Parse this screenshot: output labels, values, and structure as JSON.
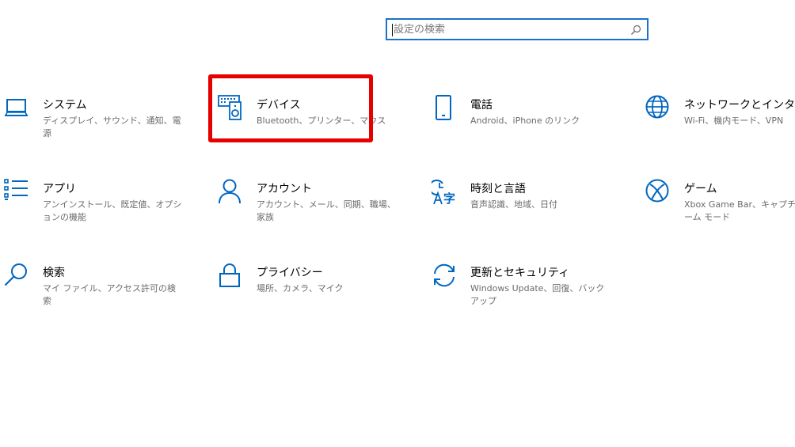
{
  "search": {
    "placeholder": "設定の検索",
    "value": ""
  },
  "accent_color": "#0067c0",
  "highlight_color": "#e60000",
  "categories": [
    {
      "icon": "laptop-icon",
      "title": "システム",
      "desc": "ディスプレイ、サウンド、通知、電源"
    },
    {
      "icon": "devices-icon",
      "title": "デバイス",
      "desc": "Bluetooth、プリンター、マウス"
    },
    {
      "icon": "phone-icon",
      "title": "電話",
      "desc": "Android、iPhone のリンク"
    },
    {
      "icon": "globe-icon",
      "title": "ネットワークとインターネット",
      "desc": "Wi-Fi、機内モード、VPN"
    },
    {
      "icon": "apps-icon",
      "title": "アプリ",
      "desc": "アンインストール、既定値、オプションの機能"
    },
    {
      "icon": "person-icon",
      "title": "アカウント",
      "desc": "アカウント、メール、同期、職場、家族"
    },
    {
      "icon": "time-language-icon",
      "title": "時刻と言語",
      "desc": "音声認識、地域、日付"
    },
    {
      "icon": "xbox-icon",
      "title": "ゲーム",
      "desc": "Xbox Game Bar、キャプチャ、ゲーム モード"
    },
    {
      "icon": "search-icon",
      "title": "検索",
      "desc": "マイ ファイル、アクセス許可の検索"
    },
    {
      "icon": "lock-icon",
      "title": "プライバシー",
      "desc": "場所、カメラ、マイク"
    },
    {
      "icon": "sync-icon",
      "title": "更新とセキュリティ",
      "desc": "Windows Update、回復、バックアップ"
    }
  ]
}
